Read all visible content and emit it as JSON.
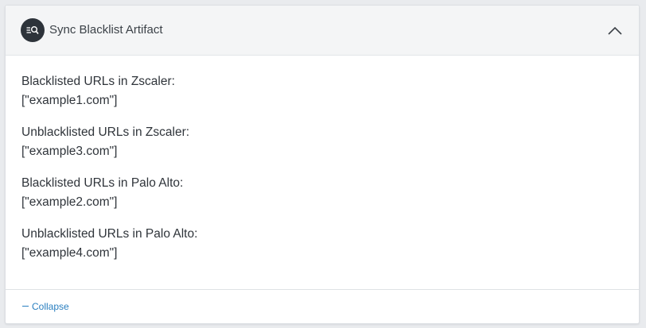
{
  "panel": {
    "title": "Sync Blacklist Artifact"
  },
  "entries": [
    {
      "label": "Blacklisted URLs in Zscaler:",
      "value": "[\"example1.com\"]"
    },
    {
      "label": "Unblacklisted URLs in Zscaler:",
      "value": "[\"example3.com\"]"
    },
    {
      "label": "Blacklisted URLs in Palo Alto:",
      "value": "[\"example2.com\"]"
    },
    {
      "label": "Unblacklisted URLs in Palo Alto:",
      "value": "[\"example4.com\"]"
    }
  ],
  "footer": {
    "collapse_label": "Collapse"
  },
  "icons": {
    "header": "list-search-icon",
    "toggle": "chevron-up-icon",
    "collapse": "minus-icon"
  },
  "colors": {
    "link": "#2a7fc0",
    "icon_bg": "#2d333a"
  }
}
